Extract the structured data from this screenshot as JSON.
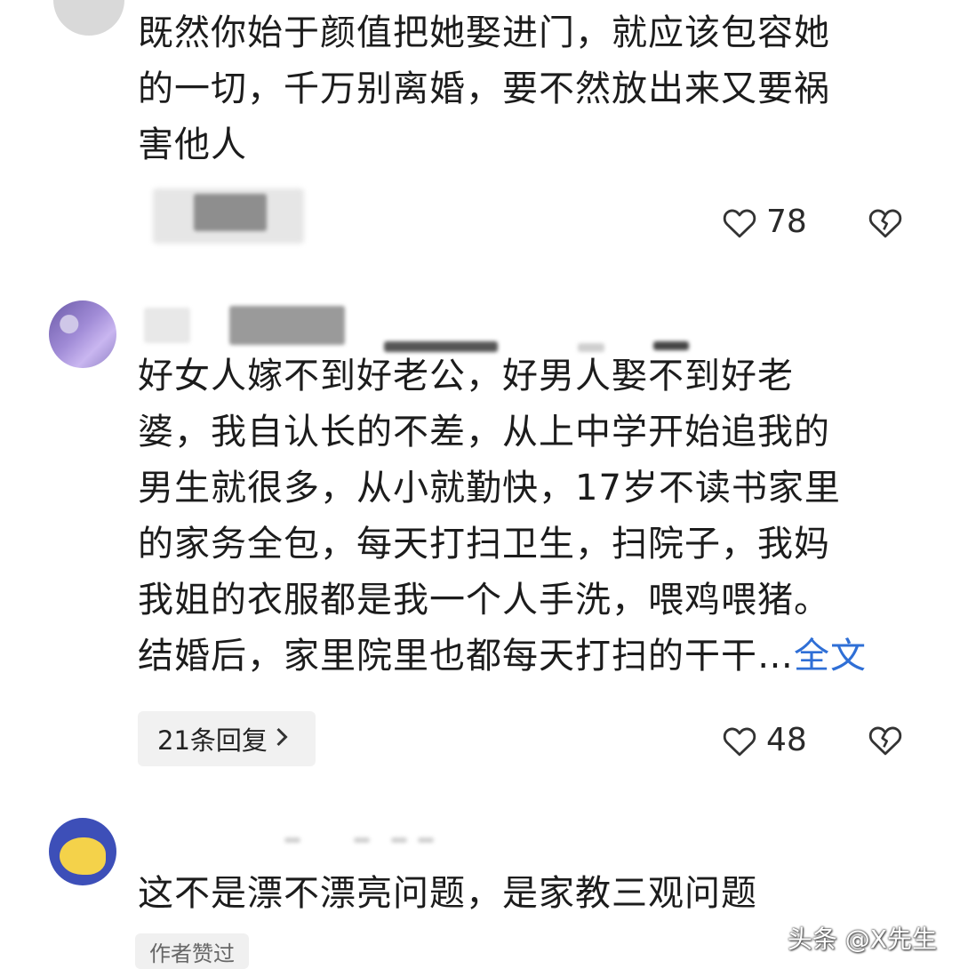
{
  "comments": [
    {
      "text_lines": [
        "既然你始于颜值把她娶进门，就应该包容她",
        "的一切，千万别离婚，要不然放出来又要祸",
        "害他人"
      ],
      "likes": "78"
    },
    {
      "text_lines": [
        "好女人嫁不到好老公，好男人娶不到好老",
        "婆，我自认长的不差，从上中学开始追我的",
        "男生就很多，从小就勤快，17岁不读书家里",
        "的家务全包，每天打扫卫生，扫院子，我妈",
        "我姐的衣服都是我一个人手洗，喂鸡喂猪。"
      ],
      "last_line": "结婚后，家里院里也都每天打扫的干干…",
      "more_label": "全文",
      "replies_label": "21条回复",
      "likes": "48"
    },
    {
      "text_lines": [
        "这不是漂不漂亮问题，是家教三观问题"
      ],
      "badge": "作者赞过"
    }
  ],
  "watermark": "头条 @X先生",
  "icons": {
    "like": "heart-outline-icon",
    "dislike": "broken-heart-icon",
    "chevron": "chevron-right-icon"
  }
}
